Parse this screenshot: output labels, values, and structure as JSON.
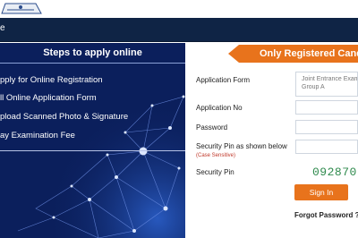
{
  "nav": {
    "item": "e"
  },
  "steps": {
    "title": "Steps to apply online",
    "items": [
      "pply for Online Registration",
      "ll Online Application Form",
      "pload Scanned Photo & Signature",
      "ay Examination Fee"
    ]
  },
  "login": {
    "header": "Only Registered Candi",
    "application_form_label": "Application Form",
    "application_form_value_line1": "Joint Entrance Exam",
    "application_form_value_line2": "Group A",
    "application_no_label": "Application No",
    "password_label": "Password",
    "security_pin_shown_label": "Security Pin as shown below",
    "case_sensitive_note": "(Case Sensitive)",
    "security_pin_label": "Security Pin",
    "security_pin_value": "092870",
    "signin_label": "Sign In",
    "forgot_label": "Forgot Password ?"
  },
  "colors": {
    "navbar": "#0f2445",
    "left_panel": "#0b1f5c",
    "accent": "#e8731c",
    "pin_text": "#2f8a4d"
  }
}
